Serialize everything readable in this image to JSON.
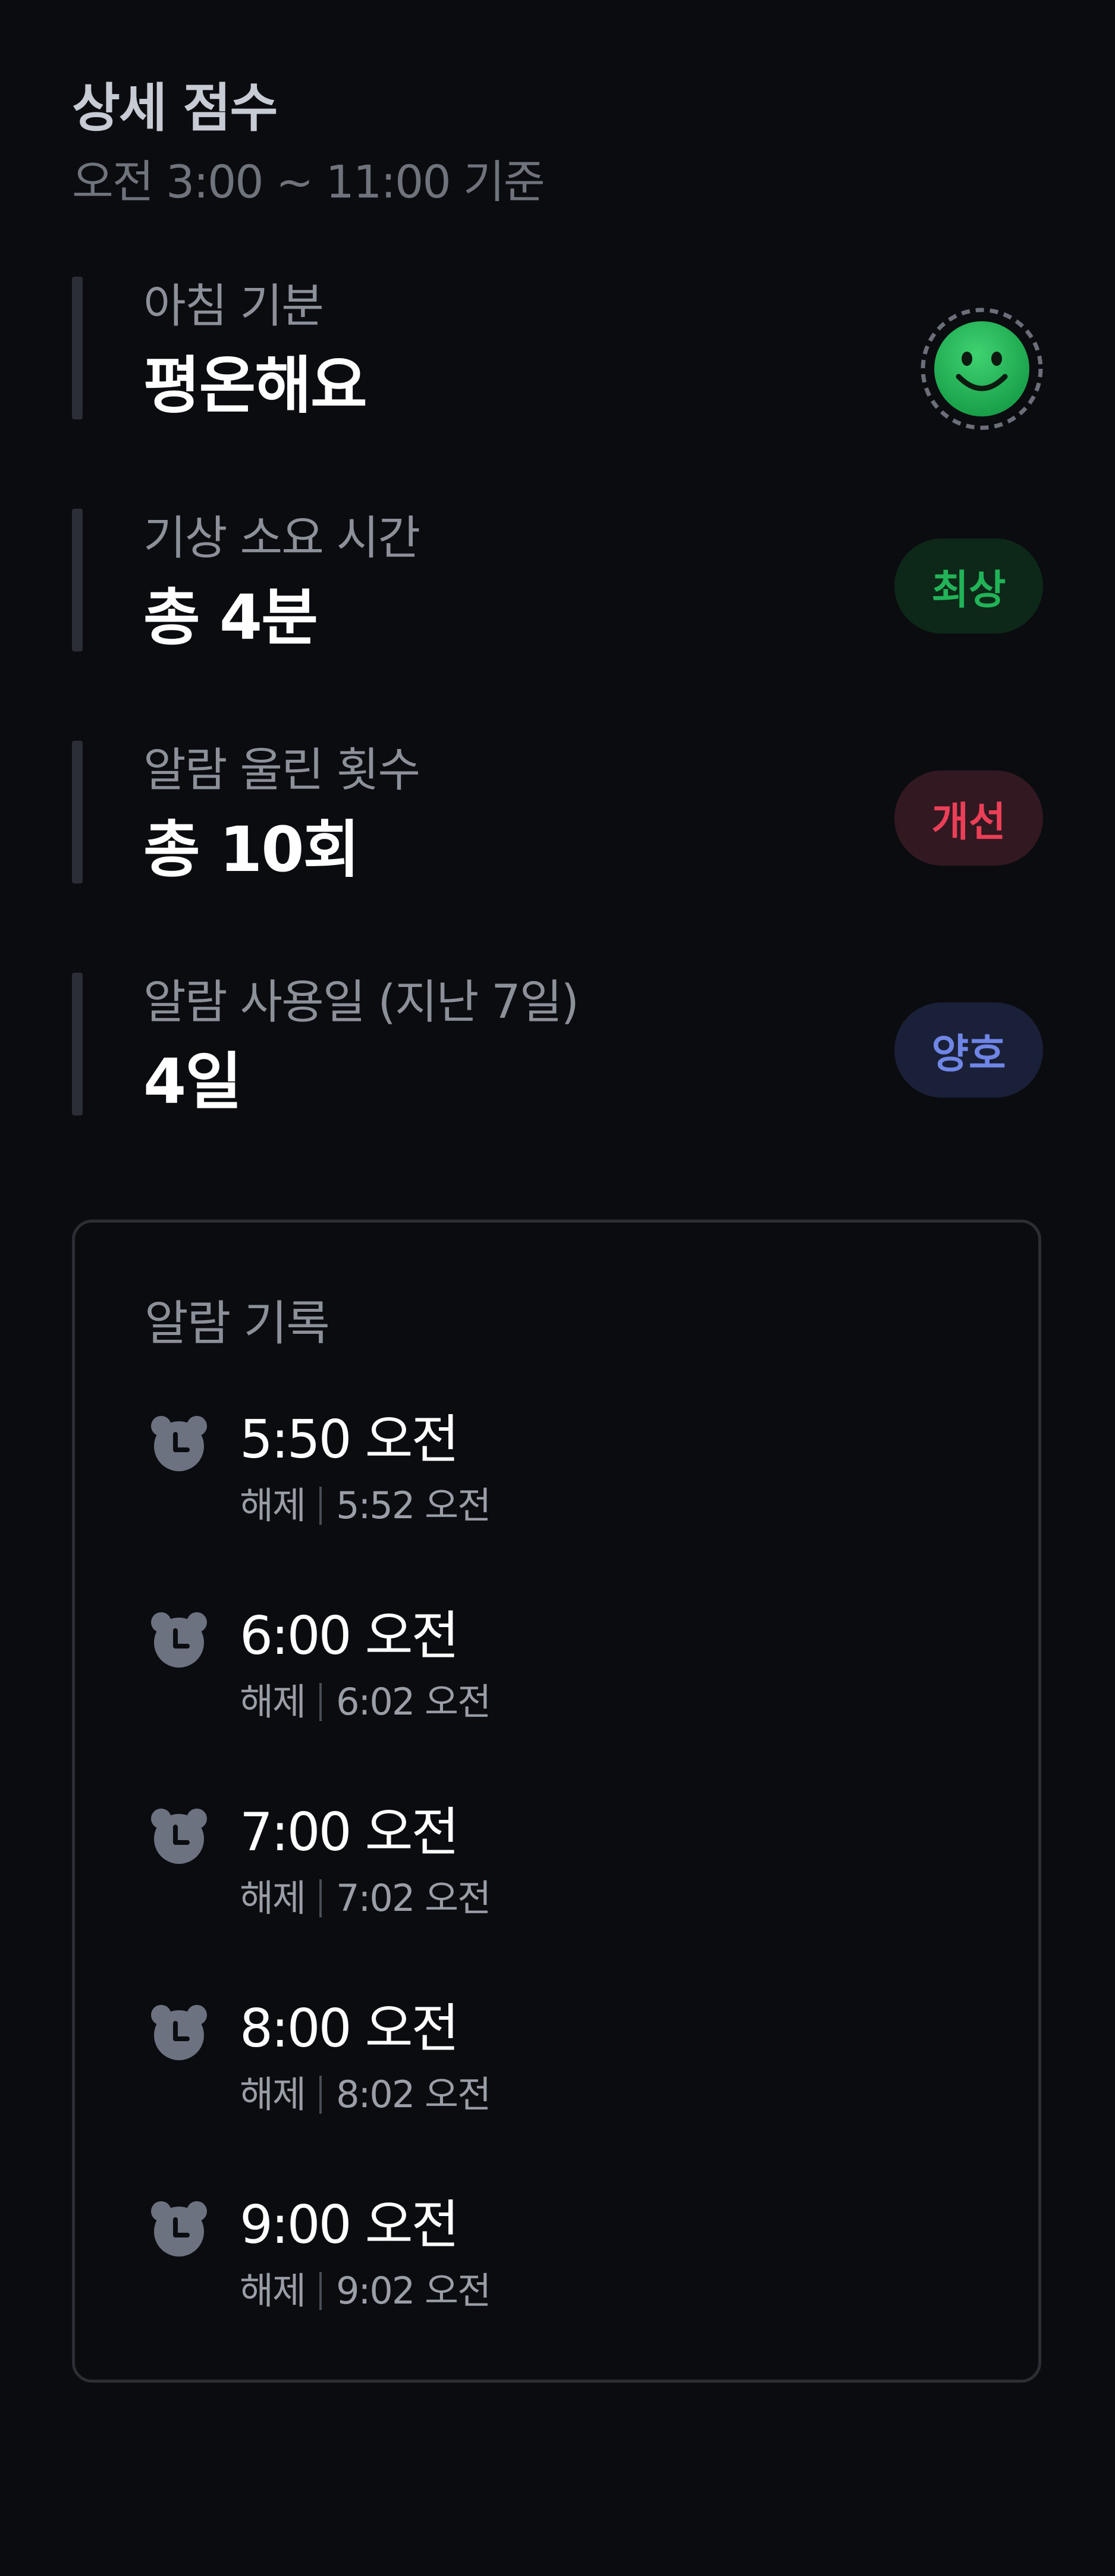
{
  "header": {
    "title": "상세 점수",
    "subtitle": "오전 3:00 ~ 11:00 기준"
  },
  "metrics": [
    {
      "label": "아침 기분",
      "value": "평온해요",
      "indicator": "smile-face",
      "indicator_color": "#2bbf5c"
    },
    {
      "label": "기상 소요 시간",
      "value": "총 4분",
      "badge": "최상",
      "badge_color": "#22b358"
    },
    {
      "label": "알람 울린 횟수",
      "value": "총 10회",
      "badge": "개선",
      "badge_color": "#ea3f57"
    },
    {
      "label": "알람 사용일 (지난 7일)",
      "value": "4일",
      "badge": "양호",
      "badge_color": "#6f86e6"
    }
  ],
  "history": {
    "title": "알람 기록",
    "icon": "alarm-clock-icon",
    "items": [
      {
        "time": "5:50 오전",
        "action": "해제",
        "dismiss_time": "5:52 오전"
      },
      {
        "time": "6:00 오전",
        "action": "해제",
        "dismiss_time": "6:02 오전"
      },
      {
        "time": "7:00 오전",
        "action": "해제",
        "dismiss_time": "7:02 오전"
      },
      {
        "time": "8:00 오전",
        "action": "해제",
        "dismiss_time": "8:02 오전"
      },
      {
        "time": "9:00 오전",
        "action": "해제",
        "dismiss_time": "9:02 오전"
      }
    ]
  },
  "colors": {
    "background": "#0b0c0f",
    "accent_green": "#22b358",
    "accent_red": "#ea3f57",
    "accent_blue": "#6f86e6"
  }
}
